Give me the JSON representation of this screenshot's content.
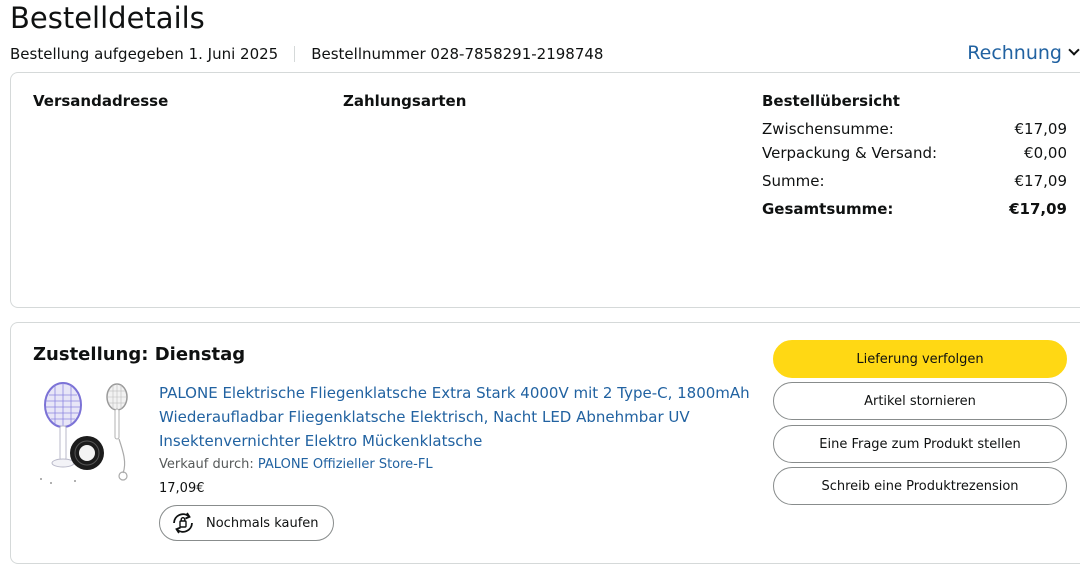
{
  "page": {
    "title": "Bestelldetails",
    "order_date": "Bestellung aufgegeben 1. Juni 2025",
    "order_number": "Bestellnummer 028-7858291-2198748",
    "invoice_label": "Rechnung"
  },
  "info_card": {
    "shipping_heading": "Versandadresse",
    "payment_heading": "Zahlungsarten",
    "summary_heading": "Bestellübersicht",
    "summary_rows": [
      {
        "label": "Zwischensumme:",
        "value": "€17,09"
      },
      {
        "label": "Verpackung & Versand:",
        "value": "€0,00"
      },
      {
        "label": "Summe:",
        "value": "€17,09"
      },
      {
        "label": "Gesamtsumme:",
        "value": "€17,09"
      }
    ]
  },
  "shipment": {
    "heading": "Zustellung: Dienstag",
    "product_title": "PALONE Elektrische Fliegenklatsche Extra Stark 4000V mit 2 Type-C, 1800mAh Wiederaufladbar Fliegenklatsche Elektrisch, Nacht LED Abnehmbar UV Insektenvernichter Elektro Mückenklatsche",
    "sold_by_prefix": "Verkauf durch:",
    "seller": "PALONE Offizieller Store-FL",
    "price": "17,09€",
    "buy_again_label": "Nochmals kaufen",
    "actions": {
      "track": "Lieferung verfolgen",
      "cancel": "Artikel stornieren",
      "question": "Eine Frage zum Produkt stellen",
      "review": "Schreib eine Produktrezension"
    }
  },
  "icons": {
    "invoice_chevron": "chevron-down-icon",
    "buy_again": "rebuy-icon"
  },
  "colors": {
    "link": "#2162a1",
    "primary_button": "#ffd814",
    "border": "#d5d9d9"
  }
}
